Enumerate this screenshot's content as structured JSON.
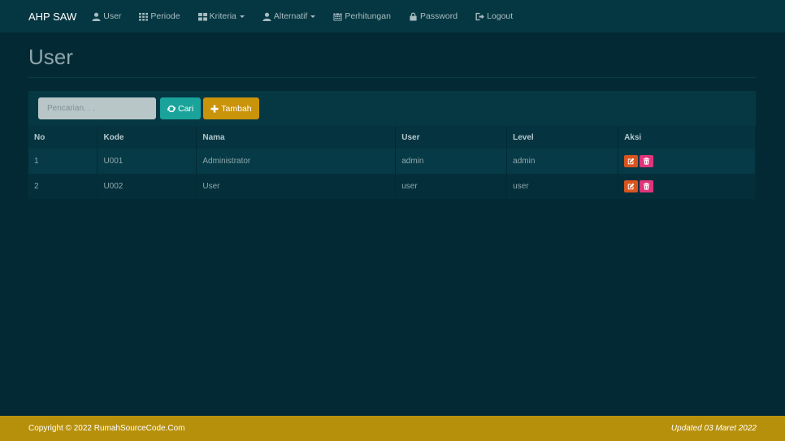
{
  "navbar": {
    "brand": "AHP SAW",
    "items": [
      {
        "label": "User",
        "icon": "user-icon",
        "dropdown": false
      },
      {
        "label": "Periode",
        "icon": "grid-icon",
        "dropdown": false
      },
      {
        "label": "Kriteria",
        "icon": "grid-large-icon",
        "dropdown": true
      },
      {
        "label": "Alternatif",
        "icon": "user-icon",
        "dropdown": true
      },
      {
        "label": "Perhitungan",
        "icon": "calendar-icon",
        "dropdown": false
      },
      {
        "label": "Password",
        "icon": "lock-icon",
        "dropdown": false
      },
      {
        "label": "Logout",
        "icon": "logout-icon",
        "dropdown": false
      }
    ]
  },
  "page": {
    "title": "User"
  },
  "toolbar": {
    "search_placeholder": "Pencarian. . .",
    "search_value": "",
    "cari_label": "Cari",
    "tambah_label": "Tambah"
  },
  "table": {
    "headers": [
      "No",
      "Kode",
      "Nama",
      "User",
      "Level",
      "Aksi"
    ],
    "rows": [
      {
        "no": "1",
        "kode": "U001",
        "nama": "Administrator",
        "user": "admin",
        "level": "admin"
      },
      {
        "no": "2",
        "kode": "U002",
        "nama": "User",
        "user": "user",
        "level": "user"
      }
    ]
  },
  "footer": {
    "copyright": "Copyright © 2022 RumahSourceCode.Com",
    "updated": "Updated 03 Maret 2022"
  },
  "colors": {
    "background": "#032a34",
    "navbar": "#053742",
    "cari_button": "#1aa39a",
    "tambah_button": "#c9930a",
    "edit_button": "#d9541e",
    "delete_button": "#e0347a",
    "footer": "#b7900b"
  }
}
